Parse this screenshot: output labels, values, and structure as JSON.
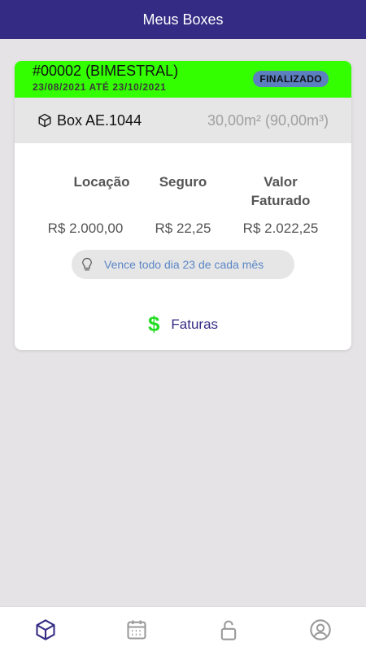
{
  "header": {
    "title": "Meus Boxes"
  },
  "contract": {
    "title": "#00002 (BIMESTRAL)",
    "period": "23/08/2021 ATÉ 23/10/2021",
    "status": "FINALIZADO",
    "box_name": "Box AE.1044",
    "box_size": "30,00m² (90,00m³)",
    "columns": [
      {
        "label_line1": "Locação",
        "label_line2": "",
        "value": "R$ 2.000,00"
      },
      {
        "label_line1": "Seguro",
        "label_line2": "",
        "value": "R$ 22,25"
      },
      {
        "label_line1": "Valor",
        "label_line2": "Faturado",
        "value": "R$ 2.022,25"
      }
    ],
    "due_hint": "Vence todo dia 23 de cada mês",
    "invoices_symbol": "$",
    "invoices_label": "Faturas"
  },
  "tabbar": {
    "tabs": [
      {
        "icon": "box-icon",
        "active": true
      },
      {
        "icon": "calendar-icon",
        "active": false
      },
      {
        "icon": "lock-open-icon",
        "active": false
      },
      {
        "icon": "user-circle-icon",
        "active": false
      }
    ]
  },
  "colors": {
    "header_bg": "#342c84",
    "card_head_bg": "#33ff00",
    "status_badge_bg": "#5b7fbf",
    "hint_text": "#5b86c5",
    "dollar": "#22dd22",
    "active_tab": "#342c84",
    "inactive_tab": "#9a9a9a"
  }
}
